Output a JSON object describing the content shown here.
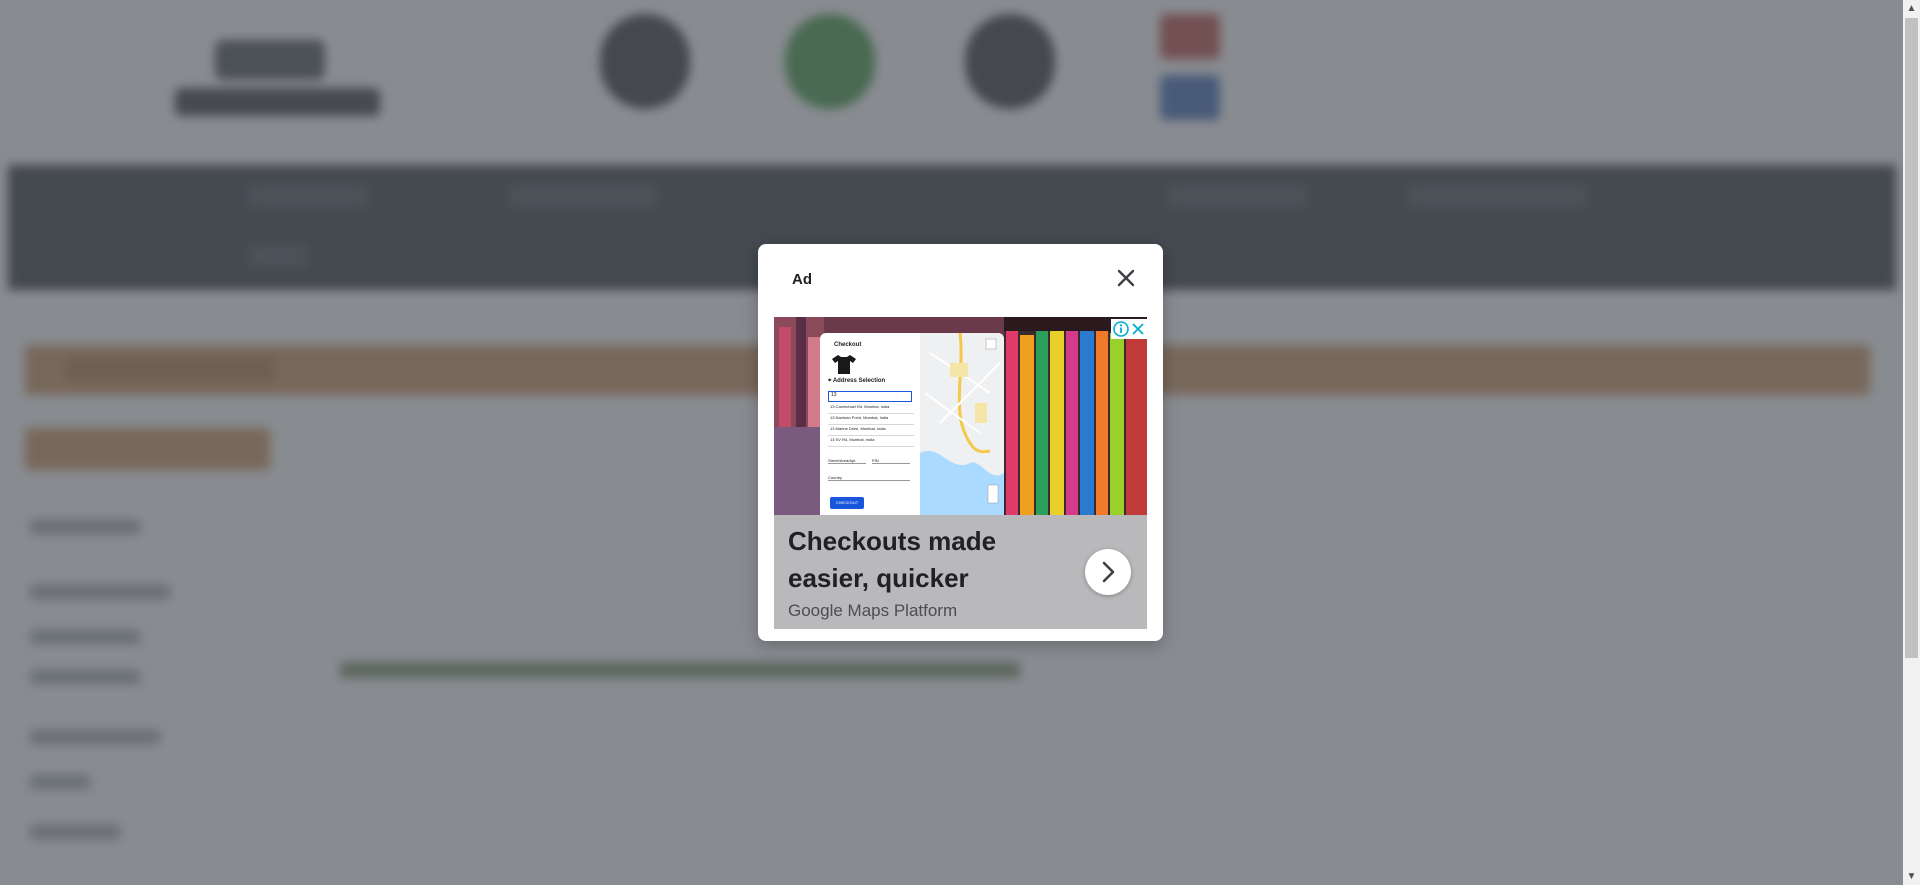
{
  "dialog": {
    "title": "Ad",
    "close_icon": "close-icon"
  },
  "ad": {
    "headline": "Checkouts made easier, quicker",
    "advertiser": "Google Maps Platform",
    "cta_icon": "chevron-right-icon",
    "info_icon": "info-icon",
    "dismiss_icon": "close-icon",
    "image_mock": {
      "title": "Checkout",
      "section": "Address Selection",
      "input_value": "13",
      "suggestions": [
        "13 Carmichael Rd, Mumbai, India",
        "13 Nariman Point, Mumbai, India",
        "13 Marine Drive, Mumbai, India",
        "13 SV Rd, Mumbai, India"
      ],
      "fields": [
        "Street/Area/Apt",
        "PIN",
        "Country"
      ],
      "button_label": "CHECKOUT"
    }
  },
  "colors": {
    "overlay": "#555a61",
    "accent_orange": "#c98a4f",
    "nav_dark": "#1f2329"
  }
}
